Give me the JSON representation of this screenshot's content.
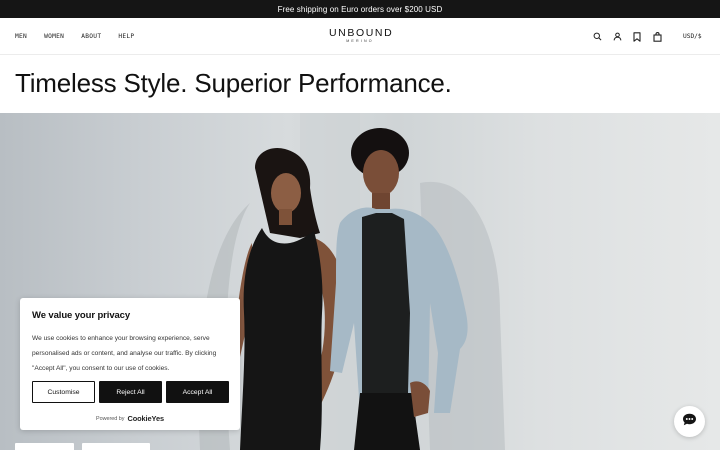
{
  "announcement": {
    "text": "Free shipping on Euro orders over $200 USD"
  },
  "nav": {
    "items": [
      {
        "label": "MEN"
      },
      {
        "label": "WOMEN"
      },
      {
        "label": "ABOUT"
      },
      {
        "label": "HELP"
      }
    ]
  },
  "logo": {
    "main": "UNBOUND",
    "sub": "MERINO"
  },
  "header_icons": [
    "search-icon",
    "account-icon",
    "bookmark-icon",
    "cart-icon"
  ],
  "currency": {
    "label": "USD/$"
  },
  "hero": {
    "headline": "Timeless Style. Superior Performance."
  },
  "cookie_banner": {
    "title": "We value your privacy",
    "body": "We use cookies to enhance your browsing experience, serve personalised ads or content, and analyse our traffic. By clicking \"Accept All\", you consent to our use of cookies.",
    "customise_label": "Customise",
    "reject_label": "Reject All",
    "accept_label": "Accept All",
    "powered_by": "Powered by",
    "powered_brand": "CookieYes"
  },
  "chat_widget": {
    "icon": "chat-icon"
  },
  "colors": {
    "announcement_bg": "#151515",
    "button_dark": "#111111",
    "page_bg": "#ffffff"
  }
}
